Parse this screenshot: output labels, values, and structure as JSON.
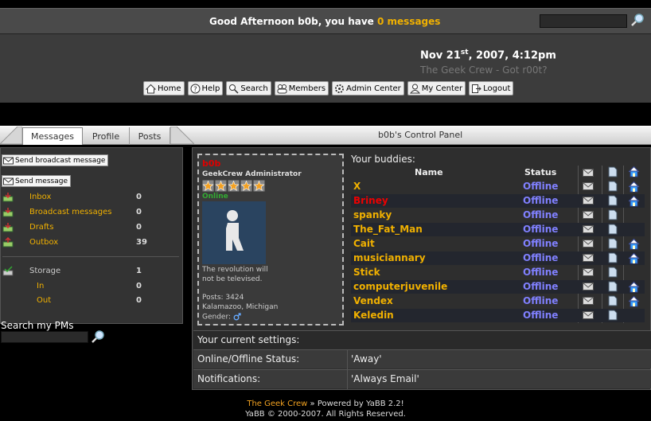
{
  "top": {
    "greeting_prefix": "Good Afternoon b0b, you have ",
    "greeting_link": "0 messages"
  },
  "header": {
    "date_main": "Nov 21",
    "date_sup": "st",
    "date_rest": ", 2007, 4:12pm",
    "tagline": "The Geek Crew - Got r00t?"
  },
  "menu": {
    "home": "Home",
    "help": "Help",
    "search": "Search",
    "members": "Members",
    "admin": "Admin Center",
    "mycenter": "My Center",
    "logout": "Logout"
  },
  "tabs": {
    "messages": "Messages",
    "profile": "Profile",
    "posts": "Posts",
    "panel_title": "b0b's Control Panel"
  },
  "sidebar": {
    "broadcast_btn": "Send broadcast message",
    "send_btn": "Send message",
    "folders": [
      {
        "label": "Inbox",
        "count": "0"
      },
      {
        "label": "Broadcast messages",
        "count": "0"
      },
      {
        "label": "Drafts",
        "count": "0"
      },
      {
        "label": "Outbox",
        "count": "39"
      }
    ],
    "storage": {
      "label": "Storage",
      "count": "1"
    },
    "storage_sub": [
      {
        "label": "In",
        "count": "0"
      },
      {
        "label": "Out",
        "count": "0"
      }
    ],
    "search_label": "Search my PMs"
  },
  "profile": {
    "name": "b0b",
    "role": "GeekCrew Administrator",
    "stars": 5,
    "status": "Online",
    "sig1": "The revolution will",
    "sig2": "not be televised.",
    "posts": "Posts: 3424",
    "location": "Kalamazoo, Michigan",
    "gender": "Gender:"
  },
  "buddies": {
    "title": "Your buddies:",
    "col_name": "Name",
    "col_status": "Status",
    "rows": [
      {
        "name": "X",
        "status": "Offline",
        "home": true
      },
      {
        "name": "Briney",
        "status": "Offline",
        "home": true,
        "red": true
      },
      {
        "name": "spanky",
        "status": "Offline",
        "home": false
      },
      {
        "name": "The_Fat_Man",
        "status": "Offline",
        "home": false
      },
      {
        "name": "Cait",
        "status": "Offline",
        "home": true
      },
      {
        "name": "musiciannary",
        "status": "Offline",
        "home": true
      },
      {
        "name": "Stick",
        "status": "Offline",
        "home": false
      },
      {
        "name": "computerjuvenile",
        "status": "Offline",
        "home": true
      },
      {
        "name": "Vendex",
        "status": "Offline",
        "home": true
      },
      {
        "name": "Keledin",
        "status": "Offline",
        "home": false
      }
    ]
  },
  "settings": {
    "title": "Your current settings:",
    "rows": [
      {
        "key": "Online/Offline Status:",
        "value": "'Away'"
      },
      {
        "key": "Notifications:",
        "value": "'Always Email'"
      }
    ]
  },
  "footer": {
    "site": "The Geek Crew",
    "powered": " » Powered by YaBB 2.2!",
    "copyright": "YaBB © 2000-2007. All Rights Reserved."
  },
  "colors": {
    "accent": "#f0b000",
    "offline": "#8080ff",
    "online": "#33aa33",
    "admin_name": "#dd0000"
  }
}
